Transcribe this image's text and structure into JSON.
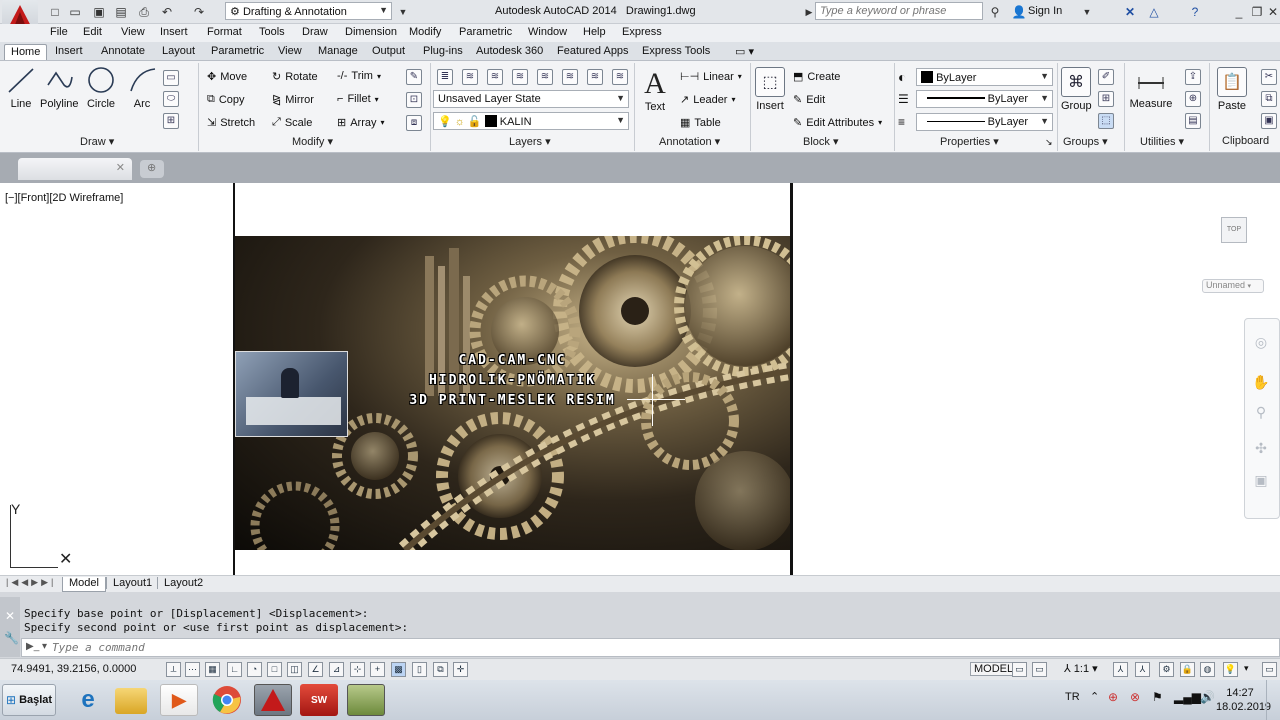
{
  "app": {
    "title": "Autodesk AutoCAD 2014",
    "drawing_name": "Drawing1.dwg",
    "workspace": "Drafting & Annotation",
    "search_placeholder": "Type a keyword or phrase",
    "sign_in": "Sign In"
  },
  "menu": [
    "File",
    "Edit",
    "View",
    "Insert",
    "Format",
    "Tools",
    "Draw",
    "Dimension",
    "Modify",
    "Parametric",
    "Window",
    "Help",
    "Express"
  ],
  "ribbon_tabs": [
    "Home",
    "Insert",
    "Annotate",
    "Layout",
    "Parametric",
    "View",
    "Manage",
    "Output",
    "Plug-ins",
    "Autodesk 360",
    "Featured Apps",
    "Express Tools"
  ],
  "active_tab": "Home",
  "ribbon": {
    "draw": {
      "title": "Draw",
      "line": "Line",
      "polyline": "Polyline",
      "circle": "Circle",
      "arc": "Arc"
    },
    "modify": {
      "title": "Modify",
      "move": "Move",
      "rotate": "Rotate",
      "trim": "Trim",
      "copy": "Copy",
      "mirror": "Mirror",
      "fillet": "Fillet",
      "stretch": "Stretch",
      "scale": "Scale",
      "array": "Array"
    },
    "layers": {
      "title": "Layers",
      "layer_state": "Unsaved Layer State",
      "current_layer": "KALIN"
    },
    "annotation": {
      "title": "Annotation",
      "text": "Text",
      "linear": "Linear",
      "leader": "Leader",
      "table": "Table"
    },
    "block": {
      "title": "Block",
      "insert": "Insert",
      "create": "Create",
      "edit": "Edit",
      "edit_attributes": "Edit Attributes"
    },
    "properties": {
      "title": "Properties",
      "color": "ByLayer",
      "linetype": "ByLayer",
      "lineweight": "ByLayer"
    },
    "groups": {
      "title": "Groups",
      "group": "Group"
    },
    "utilities": {
      "title": "Utilities",
      "measure": "Measure"
    },
    "clipboard": {
      "title": "Clipboard",
      "paste": "Paste"
    }
  },
  "viewport": {
    "label": "[−][Front][2D Wireframe]",
    "viewcube_face": "TOP",
    "ucs_name": "Unnamed",
    "axis_y": "Y",
    "image_text": [
      "CAD-CAM-CNC",
      "HIDROLIK-PNÖMATIK",
      "3D PRINT-MESLEK RESIM"
    ]
  },
  "layout_tabs": [
    "Model",
    "Layout1",
    "Layout2"
  ],
  "command": {
    "history": [
      "Specify base point or [Displacement] <Displacement>:",
      "Specify second point or <use first point as displacement>:"
    ],
    "placeholder": "Type a command"
  },
  "status": {
    "coordinates": "74.9491, 39.2156, 0.0000",
    "space": "MODEL",
    "scale": "1:1"
  },
  "taskbar": {
    "start": "Başlat",
    "lang": "TR",
    "time": "14:27",
    "date": "18.02.2019",
    "apps": [
      "internet-explorer",
      "file-explorer",
      "media-player",
      "chrome",
      "autocad",
      "solidworks-2015",
      "app"
    ]
  },
  "colors": {
    "accent": "#c31a1a",
    "ribbon_bg": "#f3f4f6",
    "tab_active": "#ffffff"
  }
}
